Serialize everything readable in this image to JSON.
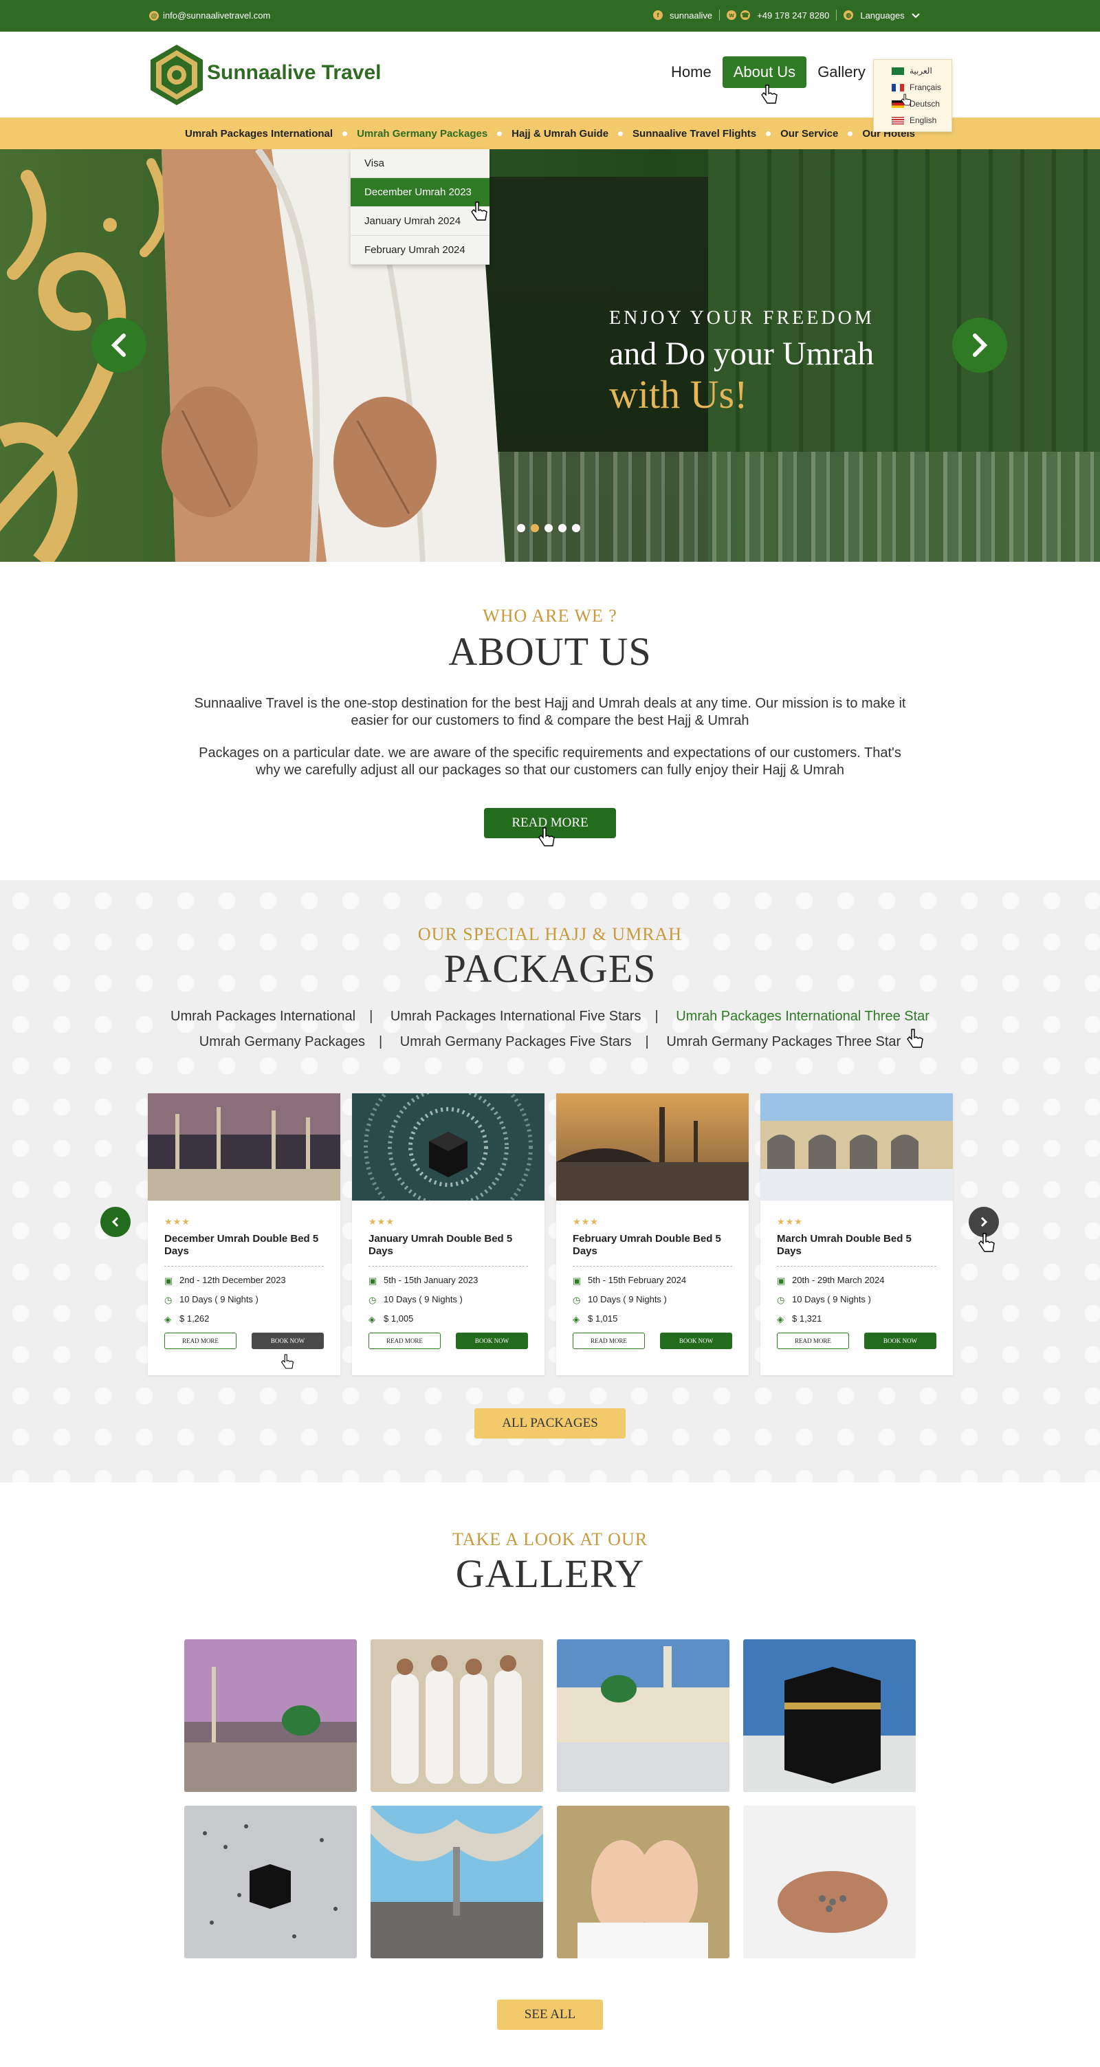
{
  "topbar": {
    "email": "info@sunnaalivetravel.com",
    "facebook": "sunnaalive",
    "phone": "+49 178  247  8280",
    "languages_label": "Languages",
    "languages": [
      "العربية",
      "Français",
      "Deutsch",
      "English"
    ]
  },
  "header": {
    "brand": "Sunnaalive Travel",
    "nav": [
      "Home",
      "About Us",
      "Gallery"
    ],
    "active_nav": "About Us"
  },
  "subnav": {
    "items": [
      "Umrah Packages International",
      "Umrah Germany Packages",
      "Hajj & Umrah Guide",
      "Sunnaalive Travel Flights",
      "Our Service",
      "Our Hotels"
    ],
    "dropdown": [
      "Visa",
      "December Umrah 2023",
      "January Umrah 2024",
      "February Umrah 2024"
    ]
  },
  "hero": {
    "line1": "ENJOY YOUR FREEDOM",
    "line2": "and Do your Umrah",
    "line3": "with Us!",
    "slide_count": 5,
    "active_slide": 2
  },
  "about": {
    "eyebrow": "WHO ARE WE ?",
    "title": "ABOUT US",
    "p1": "Sunnaalive Travel is the one-stop destination for the best Hajj and Umrah deals at any time. Our mission is to make it easier for our customers to find & compare the best Hajj & Umrah",
    "p2": "Packages on a particular date. we are aware of the specific requirements and expectations of our customers. That's why we carefully adjust all our packages so that our customers can fully enjoy their Hajj & Umrah",
    "button": "READ MORE"
  },
  "packages": {
    "eyebrow": "OUR SPECIAL HAJJ & UMRAH",
    "title": "PACKAGES",
    "tabs_row1": [
      "Umrah Packages International",
      "Umrah Packages International Five Stars",
      "Umrah Packages International Three Star"
    ],
    "tabs_row2": [
      "Umrah Germany Packages",
      "Umrah Germany Packages Five Stars",
      "Umrah Germany Packages Three Star"
    ],
    "cards": [
      {
        "stars": "★★★",
        "title": "December Umrah Double Bed 5 Days",
        "date": "2nd - 12th December 2023",
        "duration": "10 Days  ( 9 Nights )",
        "price": "$ 1,262",
        "read_more": "READ MORE",
        "book_now": "BOOK NOW"
      },
      {
        "stars": "★★★",
        "title": "January Umrah Double Bed 5 Days",
        "date": "5th - 15th January 2023",
        "duration": "10 Days  ( 9 Nights )",
        "price": "$ 1,005",
        "read_more": "READ MORE",
        "book_now": "BOOK NOW"
      },
      {
        "stars": "★★★",
        "title": "February Umrah Double Bed 5 Days",
        "date": "5th - 15th February 2024",
        "duration": "10 Days  ( 9 Nights )",
        "price": "$ 1,015",
        "read_more": "READ MORE",
        "book_now": "BOOK NOW"
      },
      {
        "stars": "★★★",
        "title": "March Umrah Double Bed 5 Days",
        "date": "20th - 29th March 2024",
        "duration": "10 Days  ( 9 Nights )",
        "price": "$ 1,321",
        "read_more": "READ MORE",
        "book_now": "BOOK NOW"
      }
    ],
    "button": "ALL PACKAGES"
  },
  "gallery": {
    "eyebrow": "TAKE A LOOK AT OUR",
    "title": "GALLERY",
    "button": "SEE ALL"
  },
  "colors": {
    "brand_green": "#2f6b23",
    "button_green": "#236b1d",
    "gold": "#e2b659",
    "subnav_gold": "#f2ca6b"
  }
}
